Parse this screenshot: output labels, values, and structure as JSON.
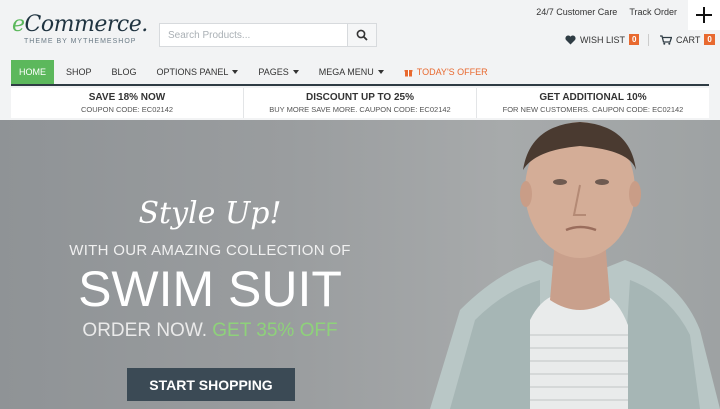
{
  "logo": {
    "prefix": "e",
    "main": "Commerce.",
    "tagline": "THEME BY MYTHEMESHOP"
  },
  "search": {
    "placeholder": "Search Products...",
    "icon": "search-icon"
  },
  "toplinks": {
    "customer_care": "24/7 Customer Care",
    "track_order": "Track Order"
  },
  "wishlist": {
    "label": "WISH LIST",
    "count": "0",
    "icon": "heart-icon"
  },
  "cart": {
    "label": "CART",
    "count": "0",
    "icon": "cart-icon"
  },
  "nav": {
    "items": [
      {
        "label": "HOME",
        "active": true
      },
      {
        "label": "SHOP"
      },
      {
        "label": "BLOG"
      },
      {
        "label": "OPTIONS PANEL",
        "dropdown": true
      },
      {
        "label": "PAGES",
        "dropdown": true
      },
      {
        "label": "MEGA MENU",
        "dropdown": true
      },
      {
        "label": "TODAY'S OFFER",
        "icon": "gift-icon"
      }
    ]
  },
  "promos": [
    {
      "title": "SAVE 18% NOW",
      "sub": "COUPON CODE: EC02142"
    },
    {
      "title": "DISCOUNT UP TO 25%",
      "sub": "BUY MORE SAVE MORE. CAUPON CODE: EC02142"
    },
    {
      "title": "GET ADDITIONAL 10%",
      "sub": "FOR NEW CUSTOMERS. CAUPON CODE: EC02142"
    }
  ],
  "hero": {
    "tagline": "Style Up!",
    "line1": "WITH OUR AMAZING COLLECTION OF",
    "headline": "SWIM SUIT",
    "order": "ORDER NOW.",
    "offer": "GET 35% OFF",
    "cta": "START SHOPPING"
  },
  "colors": {
    "accent": "#5cb85c",
    "badge": "#e8692f",
    "dark": "#3b4a55",
    "offer_green": "#8ed27a"
  }
}
